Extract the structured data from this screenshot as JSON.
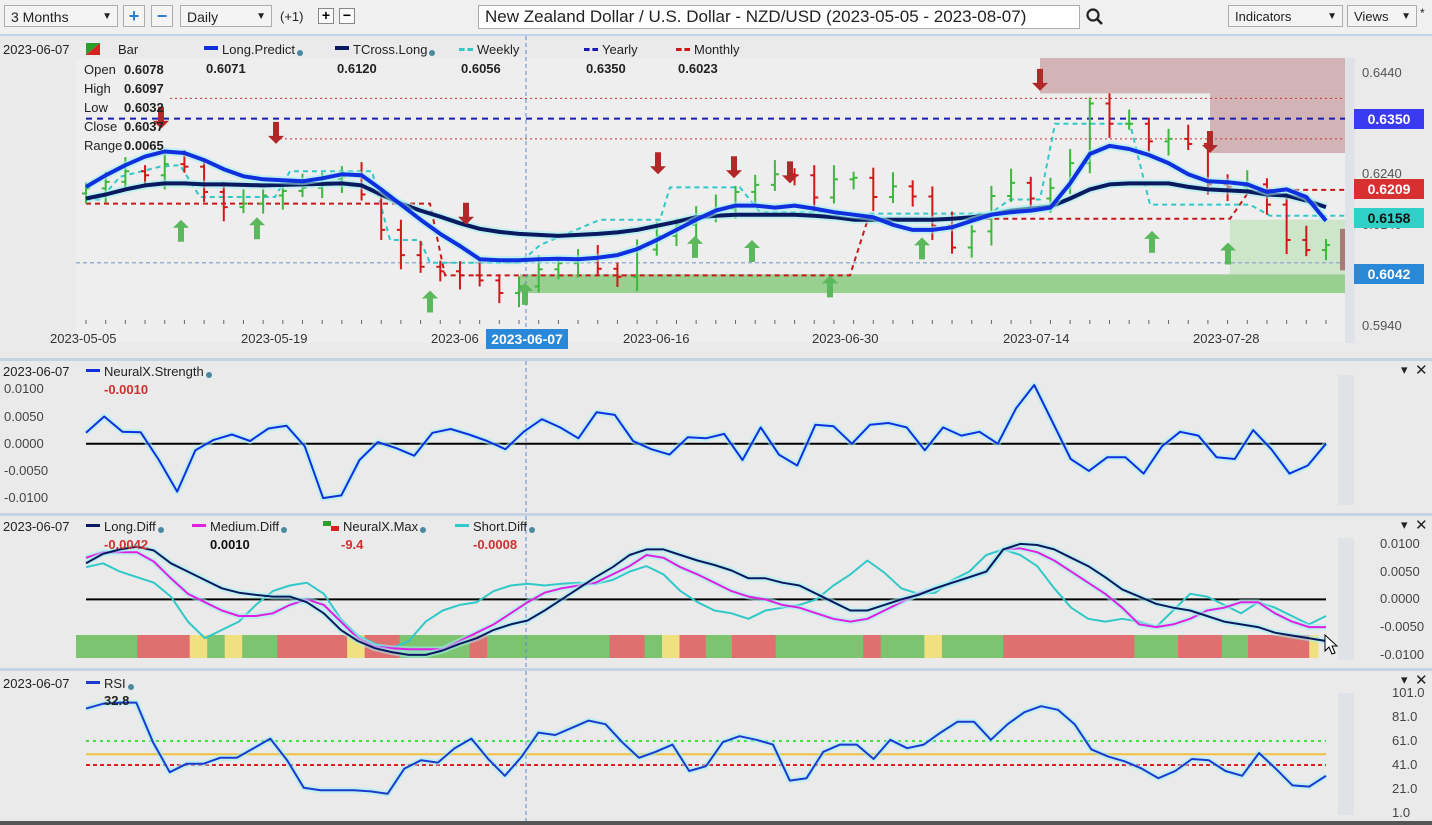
{
  "toolbar": {
    "range_select": "3 Months",
    "zoom_in_label": "+",
    "zoom_out_label": "−",
    "interval_select": "Daily",
    "offset_label": "(+1)",
    "step_plus": "+",
    "step_minus": "−",
    "title": "New Zealand Dollar / U.S. Dollar - NZD/USD (2023-05-05 - 2023-08-07)",
    "search_icon": "search-icon",
    "indicators_label": "Indicators",
    "views_label": "Views",
    "star": "*"
  },
  "colors": {
    "up": "#3cb83c",
    "down": "#d01818",
    "long_predict": "#1030e0",
    "tcross_long": "#0a1a60",
    "weekly": "#30c8c8",
    "yearly": "#1a1ab0",
    "monthly": "#c81818",
    "long_diff": "#0a1a60",
    "medium_diff": "#e020e0",
    "short_diff": "#30c8c8",
    "rsi": "#1a3ad0",
    "tag_yearly": "#3a3af0",
    "tag_monthly": "#d83030",
    "tag_weekly": "#30d0c8",
    "tag_price": "#2a88d8",
    "max_green": "#7cc470",
    "max_red": "#e07070",
    "max_yellow": "#f0e080"
  },
  "main_panel": {
    "date": "2023-06-07",
    "bar_label": "Bar",
    "ohlc": [
      {
        "label": "Open",
        "value": "0.6078"
      },
      {
        "label": "High",
        "value": "0.6097"
      },
      {
        "label": "Low",
        "value": "0.6032"
      },
      {
        "label": "Close",
        "value": "0.6037"
      },
      {
        "label": "Range",
        "value": "0.0065"
      }
    ],
    "legend": [
      {
        "name": "Long.Predict",
        "value": "0.6071"
      },
      {
        "name": "TCross.Long",
        "value": "0.6120"
      },
      {
        "name": "Weekly",
        "value": "0.6056"
      },
      {
        "name": "Yearly",
        "value": "0.6350"
      },
      {
        "name": "Monthly",
        "value": "0.6023"
      }
    ],
    "price_tags": [
      {
        "name": "yearly",
        "value": "0.6350"
      },
      {
        "name": "monthly",
        "value": "0.6209"
      },
      {
        "name": "weekly",
        "value": "0.6158"
      },
      {
        "name": "price",
        "value": "0.6042"
      }
    ],
    "crosshair_date": "2023-06-07"
  },
  "strength_panel": {
    "date": "2023-06-07",
    "legend": [
      {
        "name": "NeuralX.Strength",
        "value": "-0.0010"
      }
    ]
  },
  "diff_panel": {
    "date": "2023-06-07",
    "legend": [
      {
        "name": "Long.Diff",
        "value": "-0.0042"
      },
      {
        "name": "Medium.Diff",
        "value": "0.0010"
      },
      {
        "name": "NeuralX.Max",
        "value": "-9.4"
      },
      {
        "name": "Short.Diff",
        "value": "-0.0008"
      }
    ]
  },
  "rsi_panel": {
    "date": "2023-06-07",
    "legend": [
      {
        "name": "RSI",
        "value": "32.8"
      }
    ]
  },
  "chart_data": [
    {
      "type": "ohlc",
      "title": "NZD/USD Daily",
      "x_ticks": [
        "2023-05-05",
        "2023-05-19",
        "2023-06",
        "2023-06-16",
        "2023-06-30",
        "2023-07-14",
        "2023-07-28"
      ],
      "y_ticks": [
        "0.6440",
        "0.6240",
        "0.6140",
        "0.5940"
      ],
      "ylim": [
        0.592,
        0.647
      ],
      "bars_count": 64,
      "close": [
        0.6212,
        0.6225,
        0.6246,
        0.6238,
        0.626,
        0.6255,
        0.6205,
        0.6175,
        0.6182,
        0.6198,
        0.6207,
        0.6213,
        0.6231,
        0.6236,
        0.62,
        0.613,
        0.608,
        0.6057,
        0.6048,
        0.604,
        0.603,
        0.6005,
        0.6018,
        0.6052,
        0.6064,
        0.6072,
        0.6053,
        0.6037,
        0.6091,
        0.6118,
        0.614,
        0.6157,
        0.6172,
        0.6205,
        0.6219,
        0.624,
        0.6238,
        0.6194,
        0.623,
        0.6233,
        0.6195,
        0.6216,
        0.6196,
        0.6138,
        0.6095,
        0.6127,
        0.6197,
        0.6223,
        0.6192,
        0.6213,
        0.6262,
        0.638,
        0.634,
        0.634,
        0.6305,
        0.631,
        0.63,
        0.622,
        0.6215,
        0.622,
        0.618,
        0.611,
        0.609,
        0.61
      ],
      "series": [
        {
          "name": "Long.Predict",
          "values": [
            0.6215,
            0.6238,
            0.6258,
            0.6275,
            0.6285,
            0.6282,
            0.6268,
            0.625,
            0.6236,
            0.623,
            0.6228,
            0.6226,
            0.6232,
            0.624,
            0.6238,
            0.621,
            0.618,
            0.615,
            0.6122,
            0.6098,
            0.6072,
            0.607,
            0.607,
            0.6072,
            0.6073,
            0.6072,
            0.6075,
            0.608,
            0.6092,
            0.611,
            0.613,
            0.615,
            0.6168,
            0.6178,
            0.6178,
            0.6174,
            0.6178,
            0.6172,
            0.6165,
            0.616,
            0.6155,
            0.614,
            0.613,
            0.613,
            0.6135,
            0.6148,
            0.616,
            0.6165,
            0.6168,
            0.6174,
            0.6222,
            0.628,
            0.6296,
            0.629,
            0.6278,
            0.6262,
            0.624,
            0.6226,
            0.6224,
            0.622,
            0.6205,
            0.621,
            0.6195,
            0.6148
          ]
        },
        {
          "name": "TCross.Long",
          "values": [
            0.6192,
            0.62,
            0.621,
            0.6218,
            0.6222,
            0.6222,
            0.622,
            0.622,
            0.6219,
            0.6218,
            0.6219,
            0.622,
            0.6221,
            0.6222,
            0.6218,
            0.62,
            0.6182,
            0.6168,
            0.6156,
            0.6143,
            0.6132,
            0.6126,
            0.6122,
            0.612,
            0.6118,
            0.612,
            0.6122,
            0.6125,
            0.613,
            0.6138,
            0.6146,
            0.6155,
            0.6158,
            0.616,
            0.616,
            0.616,
            0.616,
            0.6158,
            0.6155,
            0.615,
            0.615,
            0.615,
            0.615,
            0.615,
            0.6152,
            0.6155,
            0.616,
            0.6168,
            0.6172,
            0.6176,
            0.6192,
            0.621,
            0.622,
            0.6222,
            0.6222,
            0.6222,
            0.6215,
            0.621,
            0.6208,
            0.6206,
            0.62,
            0.6198,
            0.6188,
            0.6175
          ]
        }
      ],
      "levels": [
        {
          "name": "Yearly",
          "value": 0.635
        },
        {
          "name": "Monthly (current)",
          "value": 0.6209
        },
        {
          "name": "Weekly (current)",
          "value": 0.6158
        },
        {
          "name": "Price",
          "value": 0.6042
        }
      ],
      "arrows_up_count": 13,
      "arrows_down_count": 8
    },
    {
      "type": "line",
      "title": "NeuralX.Strength",
      "y_ticks": [
        "0.0100",
        "0.0050",
        "0.0000",
        "-0.0050",
        "-0.0100"
      ],
      "ylim": [
        -0.012,
        0.013
      ],
      "series": [
        {
          "name": "NeuralX.Strength",
          "values": [
            0.002,
            0.005,
            0.0022,
            0.0021,
            -0.003,
            -0.0088,
            -0.0012,
            0.0007,
            0.0017,
            0.0005,
            0.0028,
            0.0033,
            -0.0005,
            -0.01,
            -0.0095,
            -0.003,
            0.0003,
            -0.0008,
            -0.0022,
            0.002,
            0.0027,
            0.0017,
            0.0005,
            -0.001,
            0.0022,
            0.0045,
            0.003,
            0.001,
            0.0058,
            0.0053,
            0.0005,
            -0.001,
            -0.002,
            0.0012,
            0.001,
            0.0018,
            -0.003,
            0.003,
            -0.002,
            -0.004,
            0.0035,
            0.0032,
            0.0,
            0.0035,
            0.0038,
            0.003,
            -0.0012,
            0.003,
            0.0015,
            0.0022,
            0.0,
            0.0065,
            0.0108,
            0.004,
            -0.0028,
            -0.005,
            -0.0025,
            -0.0025,
            -0.0055,
            -0.0005,
            0.0022,
            0.0015,
            -0.0025,
            -0.0028,
            0.0025,
            -0.001,
            -0.0055,
            -0.004,
            0.0
          ]
        }
      ]
    },
    {
      "type": "line",
      "title": "Diff",
      "y_ticks": [
        "0.0100",
        "0.0050",
        "0.0000",
        "-0.0050",
        "-0.0100"
      ],
      "ylim": [
        -0.012,
        0.0125
      ],
      "series": [
        {
          "name": "Long.Diff",
          "values": [
            0.0065,
            0.0082,
            0.009,
            0.0095,
            0.0088,
            0.0065,
            0.005,
            0.0035,
            0.002,
            0.0012,
            0.0008,
            0.0005,
            0.0005,
            -0.0005,
            -0.0025,
            -0.0055,
            -0.0075,
            -0.0088,
            -0.0095,
            -0.01,
            -0.01,
            -0.0092,
            -0.008,
            -0.007,
            -0.0055,
            -0.0045,
            -0.0038,
            -0.002,
            0.0,
            0.002,
            0.004,
            0.0058,
            0.008,
            0.009,
            0.009,
            0.008,
            0.007,
            0.0062,
            0.0052,
            0.0038,
            0.0038,
            0.003,
            0.0025,
            0.001,
            -0.0005,
            -0.002,
            -0.002,
            -0.001,
            0.0,
            0.0008,
            0.002,
            0.003,
            0.004,
            0.005,
            0.009,
            0.01,
            0.0098,
            0.009,
            0.0075,
            0.006,
            0.004,
            0.0018,
            0.0005,
            -0.0008,
            -0.0015,
            -0.002,
            -0.003,
            -0.004,
            -0.0045,
            -0.005,
            -0.006,
            -0.0065,
            -0.007,
            -0.0075
          ]
        },
        {
          "name": "Medium.Diff",
          "values": [
            0.0075,
            0.0085,
            0.0085,
            0.0085,
            0.0068,
            0.0038,
            0.001,
            -0.0005,
            -0.002,
            -0.003,
            -0.003,
            -0.0025,
            -0.001,
            0.0,
            -0.001,
            -0.004,
            -0.007,
            -0.0085,
            -0.0088,
            -0.009,
            -0.009,
            -0.009,
            -0.0075,
            -0.006,
            -0.0045,
            -0.0025,
            -0.0005,
            0.0012,
            0.002,
            0.0025,
            0.003,
            0.0045,
            0.006,
            0.008,
            0.0075,
            0.0058,
            0.0045,
            0.003,
            0.0015,
            0.0005,
            0.0,
            -0.001,
            -0.0015,
            -0.0025,
            -0.0035,
            -0.004,
            -0.0035,
            -0.002,
            -0.0005,
            0.001,
            0.002,
            0.003,
            0.004,
            0.005,
            0.009,
            0.0092,
            0.0085,
            0.007,
            0.005,
            0.003,
            0.001,
            -0.0015,
            -0.0045,
            -0.005,
            -0.0045,
            -0.0035,
            -0.002,
            -0.0015,
            -0.0005,
            -0.0005,
            -0.0025,
            -0.004,
            -0.005,
            -0.005
          ]
        },
        {
          "name": "Short.Diff",
          "values": [
            0.0058,
            0.0065,
            0.005,
            0.004,
            0.003,
            0.0005,
            -0.004,
            -0.007,
            -0.0055,
            -0.004,
            -0.001,
            0.0015,
            0.0025,
            0.003,
            0.001,
            -0.0035,
            -0.0065,
            -0.008,
            -0.0088,
            -0.0075,
            -0.004,
            -0.002,
            -0.001,
            -0.0005,
            0.0015,
            0.0025,
            0.0028,
            0.0025,
            0.0028,
            0.003,
            0.0028,
            0.0035,
            0.005,
            0.006,
            0.0045,
            0.0015,
            -0.0005,
            -0.002,
            -0.0025,
            -0.0035,
            -0.002,
            -0.0015,
            -0.001,
            0.0,
            0.0025,
            0.0045,
            0.007,
            0.0048,
            0.002,
            0.001,
            0.0012,
            0.0035,
            0.005,
            0.008,
            0.009,
            0.008,
            0.006,
            0.002,
            -0.0015,
            -0.0035,
            -0.004,
            -0.0035,
            -0.004,
            -0.005,
            -0.002,
            0.001,
            0.0005,
            -0.001,
            -0.0025,
            -0.0005,
            -0.0015,
            -0.003,
            -0.0045,
            -0.003
          ]
        }
      ],
      "neuralx_max_blocks": [
        {
          "state": "green",
          "count": 7
        },
        {
          "state": "red",
          "count": 6
        },
        {
          "state": "yellow",
          "count": 2
        },
        {
          "state": "green",
          "count": 2
        },
        {
          "state": "yellow",
          "count": 2
        },
        {
          "state": "green",
          "count": 4
        },
        {
          "state": "red",
          "count": 8
        },
        {
          "state": "yellow",
          "count": 2
        },
        {
          "state": "red",
          "count": 4
        },
        {
          "state": "green",
          "count": 8
        },
        {
          "state": "red",
          "count": 2
        },
        {
          "state": "green",
          "count": 14
        },
        {
          "state": "red",
          "count": 4
        },
        {
          "state": "green",
          "count": 2
        },
        {
          "state": "yellow",
          "count": 2
        },
        {
          "state": "red",
          "count": 3
        },
        {
          "state": "green",
          "count": 3
        },
        {
          "state": "red",
          "count": 5
        },
        {
          "state": "green",
          "count": 10
        },
        {
          "state": "red",
          "count": 2
        },
        {
          "state": "green",
          "count": 5
        },
        {
          "state": "yellow",
          "count": 2
        },
        {
          "state": "green",
          "count": 7
        },
        {
          "state": "red",
          "count": 15
        },
        {
          "state": "green",
          "count": 5
        },
        {
          "state": "red",
          "count": 5
        },
        {
          "state": "green",
          "count": 3
        },
        {
          "state": "red",
          "count": 7
        },
        {
          "state": "yellow",
          "count": 1
        }
      ]
    },
    {
      "type": "line",
      "title": "RSI",
      "y_ticks": [
        "101.0",
        "81.0",
        "61.0",
        "41.0",
        "21.0",
        "1.0"
      ],
      "ylim": [
        1,
        101
      ],
      "levels": [
        {
          "name": "upper",
          "value": 61
        },
        {
          "name": "middle",
          "value": 50
        },
        {
          "name": "lower",
          "value": 41
        }
      ],
      "series": [
        {
          "name": "RSI",
          "values": [
            88,
            92,
            93,
            93,
            60,
            35,
            42,
            42,
            47,
            47,
            55,
            63,
            45,
            22,
            20,
            20,
            20,
            19,
            17,
            38,
            45,
            43,
            55,
            63,
            46,
            32,
            48,
            68,
            66,
            72,
            78,
            75,
            60,
            47,
            52,
            58,
            36,
            40,
            60,
            65,
            62,
            58,
            28,
            30,
            52,
            58,
            58,
            46,
            62,
            55,
            58,
            68,
            77,
            77,
            62,
            75,
            85,
            90,
            87,
            75,
            54,
            48,
            44,
            38,
            30,
            36,
            46,
            45,
            36,
            32,
            51,
            38,
            24,
            23,
            32
          ]
        }
      ]
    }
  ]
}
